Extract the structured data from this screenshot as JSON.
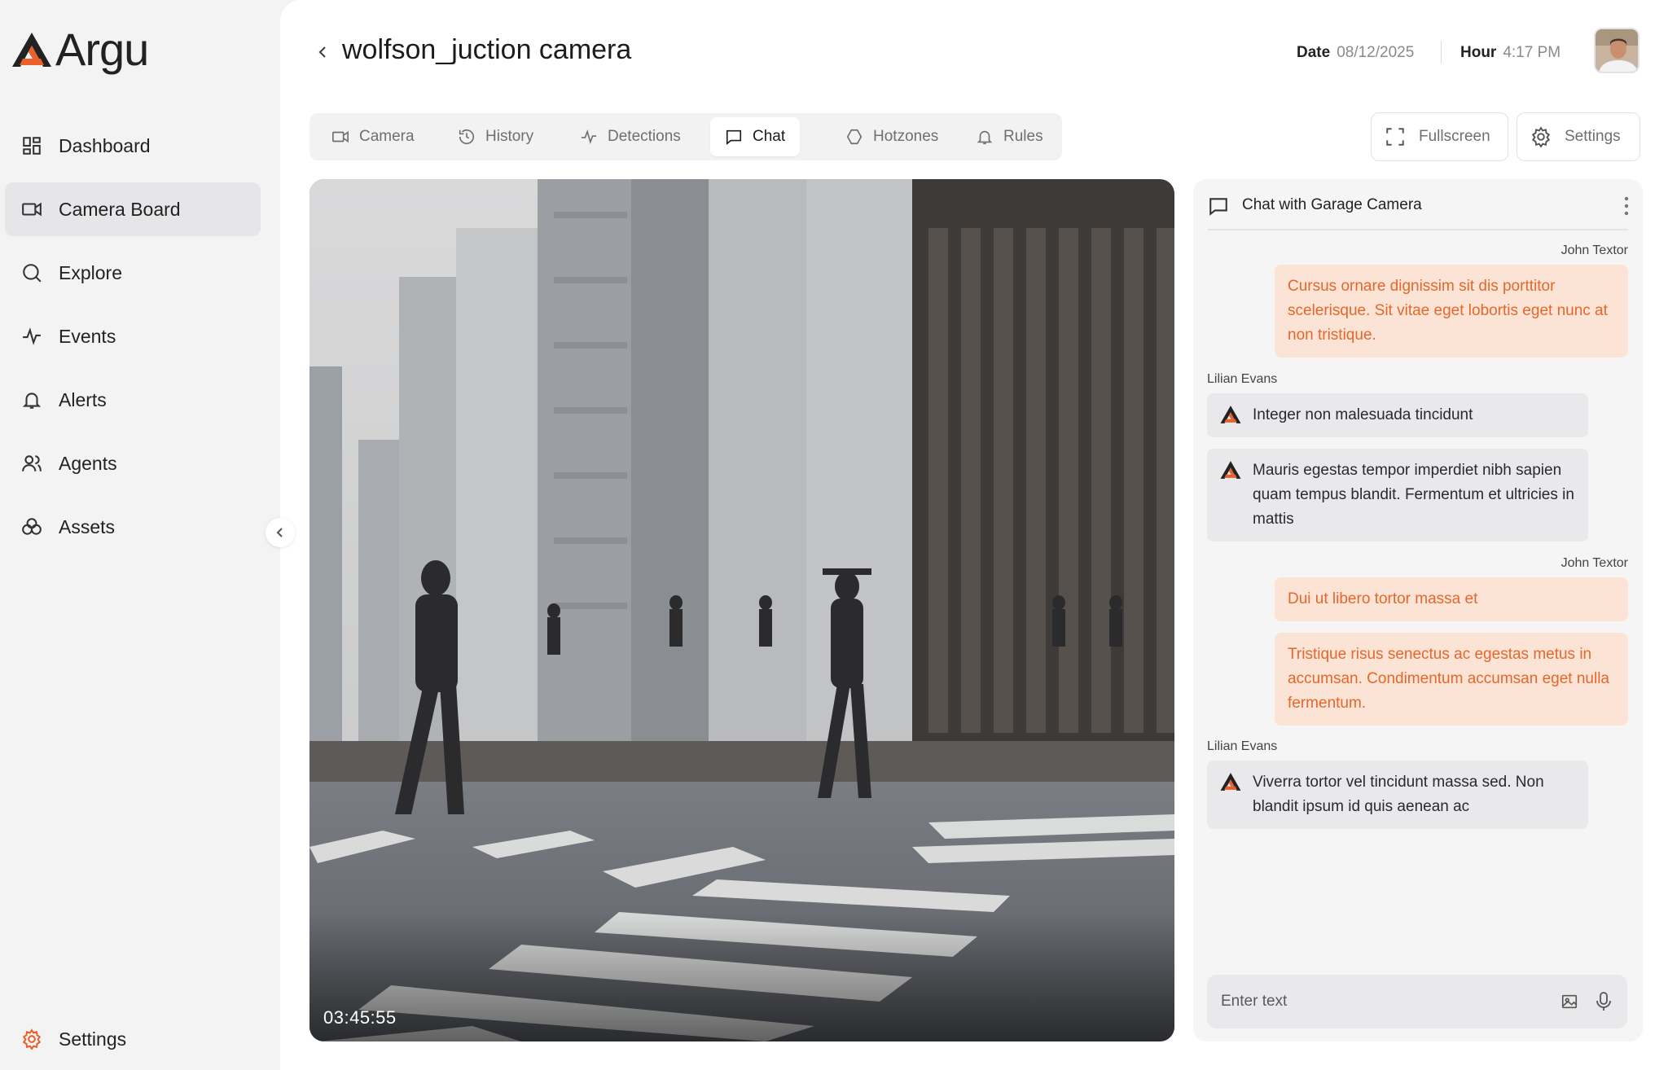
{
  "app": {
    "name": "Argu",
    "brand_color": "#e8602c"
  },
  "sidebar": {
    "items": [
      {
        "label": "Dashboard",
        "icon": "dashboard-icon",
        "active": false
      },
      {
        "label": "Camera Board",
        "icon": "camera-icon",
        "active": true
      },
      {
        "label": "Explore",
        "icon": "search-icon",
        "active": false
      },
      {
        "label": "Events",
        "icon": "pulse-icon",
        "active": false
      },
      {
        "label": "Alerts",
        "icon": "bell-icon",
        "active": false
      },
      {
        "label": "Agents",
        "icon": "users-icon",
        "active": false
      },
      {
        "label": "Assets",
        "icon": "assets-icon",
        "active": false
      }
    ],
    "settings_label": "Settings"
  },
  "header": {
    "title": "wolfson_juction camera",
    "date_label": "Date",
    "date_value": "08/12/2025",
    "hour_label": "Hour",
    "hour_value": "4:17 PM"
  },
  "tabs": [
    {
      "label": "Camera",
      "icon": "video-icon",
      "active": false
    },
    {
      "label": "History",
      "icon": "history-icon",
      "active": false
    },
    {
      "label": "Detections",
      "icon": "pulse-icon",
      "active": false
    },
    {
      "label": "Chat",
      "icon": "chat-icon",
      "active": true
    },
    {
      "label": "Hotzones",
      "icon": "hexagon-icon",
      "active": false
    },
    {
      "label": "Rules",
      "icon": "bell-icon",
      "active": false
    }
  ],
  "actions": {
    "fullscreen_label": "Fullscreen",
    "settings_label": "Settings"
  },
  "video": {
    "timestamp": "03:45:55"
  },
  "chat": {
    "title": "Chat with Garage Camera",
    "messages": [
      {
        "sender": "John Textor",
        "direction": "out",
        "texts": [
          "Cursus ornare dignissim sit dis porttitor scelerisque. Sit vitae eget lobortis eget nunc at non tristique."
        ]
      },
      {
        "sender": "Lilian Evans",
        "direction": "in",
        "texts": [
          "Integer non malesuada tincidunt",
          "Mauris egestas tempor imperdiet nibh sapien quam tempus blandit. Fermentum et ultricies in mattis"
        ]
      },
      {
        "sender": "John Textor",
        "direction": "out",
        "texts": [
          "Dui ut libero tortor massa et",
          "Tristique risus senectus ac egestas metus in accumsan. Condimentum accumsan eget nulla fermentum."
        ]
      },
      {
        "sender": "Lilian Evans",
        "direction": "in",
        "texts": [
          "Viverra tortor vel tincidunt massa sed. Non blandit ipsum id quis aenean ac"
        ]
      }
    ],
    "input_placeholder": "Enter text"
  }
}
